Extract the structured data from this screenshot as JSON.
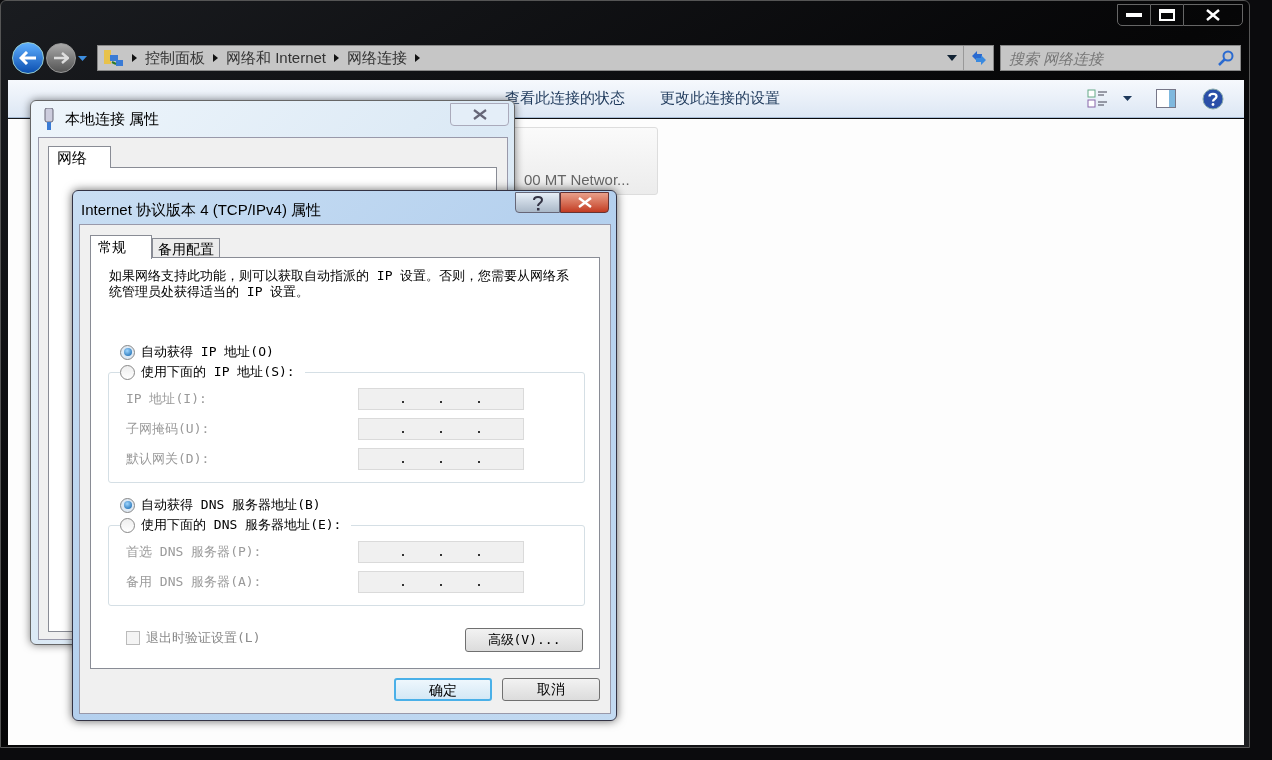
{
  "explorer": {
    "breadcrumbs": [
      "控制面板",
      "网络和 Internet",
      "网络连接"
    ],
    "search": {
      "placeholder": "搜索 网络连接"
    },
    "toolbar": [
      "查看此连接的状态",
      "更改此连接的设置"
    ],
    "connection_card": {
      "label": "00 MT Networ..."
    }
  },
  "connection_dialog": {
    "title": "本地连接 属性",
    "tabs": [
      {
        "label": "网络",
        "selected": true
      }
    ]
  },
  "ipv4_dialog": {
    "title": "Internet 协议版本 4 (TCP/IPv4) 属性",
    "tabs": [
      {
        "label": "常规",
        "selected": true
      },
      {
        "label": "备用配置",
        "selected": false
      }
    ],
    "description": "如果网络支持此功能，则可以获取自动指派的 IP 设置。否则，您需要从网络系统管理员处获得适当的 IP 设置。",
    "sections": [
      {
        "auto": {
          "label": "自动获得 IP 地址(O)",
          "selected": true
        },
        "manual": {
          "label": "使用下面的 IP 地址(S):",
          "selected": false
        },
        "disabled": true,
        "fields": [
          {
            "label": "IP 地址(I):"
          },
          {
            "label": "子网掩码(U):"
          },
          {
            "label": "默认网关(D):"
          }
        ]
      },
      {
        "auto": {
          "label": "自动获得 DNS 服务器地址(B)",
          "selected": true
        },
        "manual": {
          "label": "使用下面的 DNS 服务器地址(E):",
          "selected": false
        },
        "disabled": true,
        "fields": [
          {
            "label": "首选 DNS 服务器(P):"
          },
          {
            "label": "备用 DNS 服务器(A):"
          }
        ]
      }
    ],
    "validate_checkbox": {
      "label": "退出时验证设置(L)",
      "checked": false,
      "disabled": true
    },
    "advanced_button": "高级(V)...",
    "buttons": [
      {
        "label": "确定",
        "default": true
      },
      {
        "label": "取消",
        "default": false
      }
    ]
  }
}
